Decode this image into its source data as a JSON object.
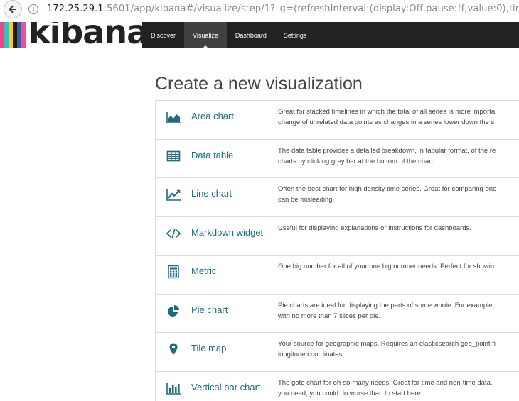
{
  "browser": {
    "url_host": "172.25.29.1",
    "url_rest": ":5601/app/kibana#/visualize/step/1?_g=(refreshInterval:(display:Off,pause:!f,value:0),tim"
  },
  "app": {
    "logo_text": "kibana",
    "logo_colors": [
      "#e8478b",
      "#3ebeb0",
      "#f7c83a",
      "#1c1c1c",
      "#3a5ba0",
      "#f04e98"
    ]
  },
  "nav": {
    "items": [
      {
        "label": "Discover",
        "active": false
      },
      {
        "label": "Visualize",
        "active": true
      },
      {
        "label": "Dashboard",
        "active": false
      },
      {
        "label": "Settings",
        "active": false
      }
    ]
  },
  "page": {
    "title": "Create a new visualization"
  },
  "visualizations": [
    {
      "icon": "area-chart-icon",
      "name": "Area chart",
      "desc": [
        "Great for stacked timelines in which the total of all series is more importa",
        "change of unrelated data points as changes in a series lower down the s"
      ]
    },
    {
      "icon": "table-icon",
      "name": "Data table",
      "desc": [
        "The data table provides a detailed breakdown, in tabular format, of the re",
        "charts by clicking grey bar at the bottom of the chart."
      ]
    },
    {
      "icon": "line-chart-icon",
      "name": "Line chart",
      "desc": [
        "Often the best chart for high density time series. Great for comparing one",
        "can be misleading."
      ]
    },
    {
      "icon": "code-icon",
      "name": "Markdown widget",
      "desc": [
        "Useful for displaying explanations or instructions for dashboards."
      ]
    },
    {
      "icon": "calculator-icon",
      "name": "Metric",
      "desc": [
        "One big number for all of your one big number needs. Perfect for showin"
      ]
    },
    {
      "icon": "pie-chart-icon",
      "name": "Pie chart",
      "desc": [
        "Pie charts are ideal for displaying the parts of some whole. For example,",
        "with no more than 7 slices per pie."
      ]
    },
    {
      "icon": "map-marker-icon",
      "name": "Tile map",
      "desc": [
        "Your source for geographic maps. Requires an elasticsearch geo_point fi",
        "longitude coordinates."
      ]
    },
    {
      "icon": "bar-chart-icon",
      "name": "Vertical bar chart",
      "desc": [
        "The goto chart for oh-so-many needs. Great for time and non-time data.",
        "you need, you could do worse than to start here."
      ]
    }
  ],
  "colors": {
    "accent": "#1f6b7a",
    "nav_bg": "#222222",
    "nav_active": "#414141"
  }
}
